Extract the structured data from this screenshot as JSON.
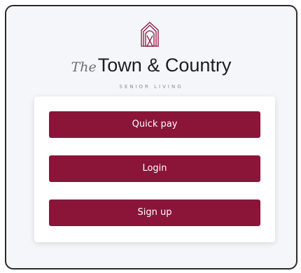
{
  "brand": {
    "prefix": "The",
    "name": "Town & Country",
    "tagline": "SENIOR LIVING",
    "accent_color": "#8a1538",
    "logo_icon": "house-arch-icon"
  },
  "actions": {
    "quick_pay_label": "Quick pay",
    "login_label": "Login",
    "signup_label": "Sign up"
  }
}
